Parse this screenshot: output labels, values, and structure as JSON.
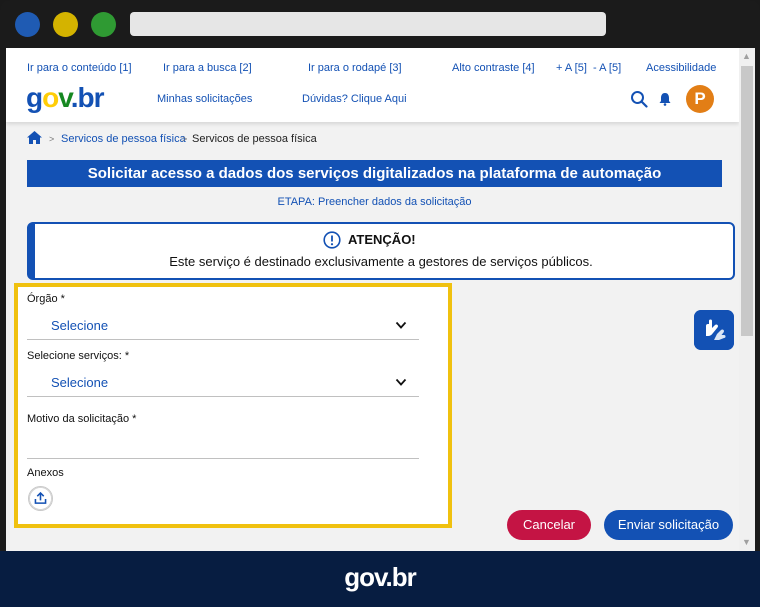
{
  "header": {
    "top_links": [
      "Ir para o conteúdo [1]",
      "Ir para a busca [2]",
      "Ir para o rodapé [3]",
      "Alto contraste [4]",
      "+ A [5]",
      "- A [5]",
      "Acessibilidade"
    ],
    "logo": {
      "g": "g",
      "o": "o",
      "v": "v",
      "br": ".br"
    },
    "nav": [
      "Minhas solicitações",
      "Dúvidas? Clique Aqui"
    ],
    "avatar_letter": "P"
  },
  "breadcrumb": {
    "item1": "Servicos de pessoa física",
    "item2": "Servicos de pessoa física"
  },
  "page": {
    "title": "Solicitar acesso a dados dos serviços digitalizados na plataforma de automação",
    "etapa": "ETAPA: Preencher dados da solicitação"
  },
  "alert": {
    "title": "ATENÇÃO!",
    "text": "Este serviço é destinado exclusivamente a gestores de serviços públicos."
  },
  "form": {
    "orgao_label": "Órgão *",
    "orgao_value": "Selecione",
    "servicos_label": "Selecione serviços: *",
    "servicos_value": "Selecione",
    "motivo_label": "Motivo da solicitação *",
    "motivo_value": "",
    "anexos_label": "Anexos"
  },
  "buttons": {
    "cancel": "Cancelar",
    "submit": "Enviar solicitação"
  },
  "footer": {
    "logo": "gov.br"
  },
  "colors": {
    "primary": "#1351b4",
    "danger": "#c41444",
    "highlight": "#f0c10f",
    "footer": "#071d41",
    "avatar": "#e27e16"
  }
}
